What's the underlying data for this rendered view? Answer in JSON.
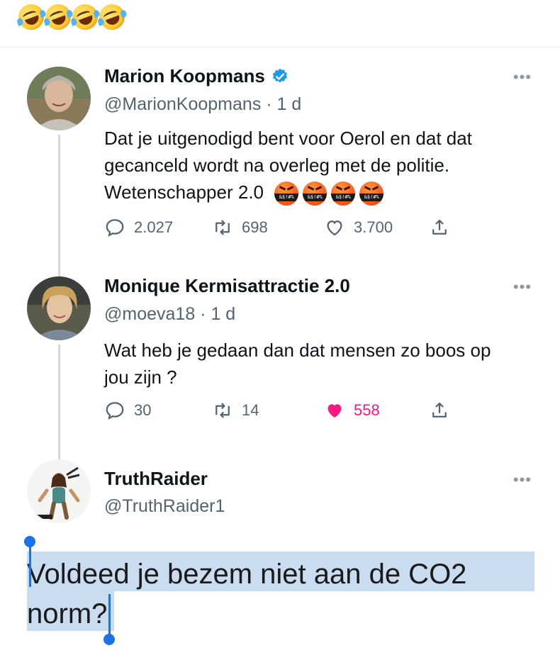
{
  "top_emojis": [
    "rolling-on-floor-laughing",
    "rolling-on-floor-laughing",
    "rolling-on-floor-laughing",
    "rolling-on-floor-laughing"
  ],
  "tweets": [
    {
      "name": "Marion Koopmans",
      "verified": true,
      "handle_time": "@MarionKoopmans · 1 d",
      "text": "Dat je uitgenodigd bent voor Oerol en dat dat gecanceld wordt na overleg met de politie. Wetenschapper 2.0",
      "trailing_emojis": [
        "face-with-symbols-on-mouth",
        "face-with-symbols-on-mouth",
        "face-with-symbols-on-mouth",
        "face-with-symbols-on-mouth"
      ],
      "replies": "2.027",
      "retweets": "698",
      "likes": "3.700",
      "liked": false
    },
    {
      "name": "Monique Kermisattractie 2.0",
      "verified": false,
      "handle_time": "@moeva18 · 1 d",
      "text": "Wat heb je gedaan dan dat mensen zo boos op jou zijn ?",
      "replies": "30",
      "retweets": "14",
      "likes": "558",
      "liked": true
    },
    {
      "name": "TruthRaider",
      "verified": false,
      "handle_time": "@TruthRaider1",
      "text": "Voldeed je bezem niet aan de CO2 norm?"
    }
  ],
  "more_label": "•••",
  "colors": {
    "accent_blue": "#1d9bf0",
    "like_pink": "#f91880",
    "selection": "#c9dcf0",
    "handle_gray": "#536471"
  }
}
